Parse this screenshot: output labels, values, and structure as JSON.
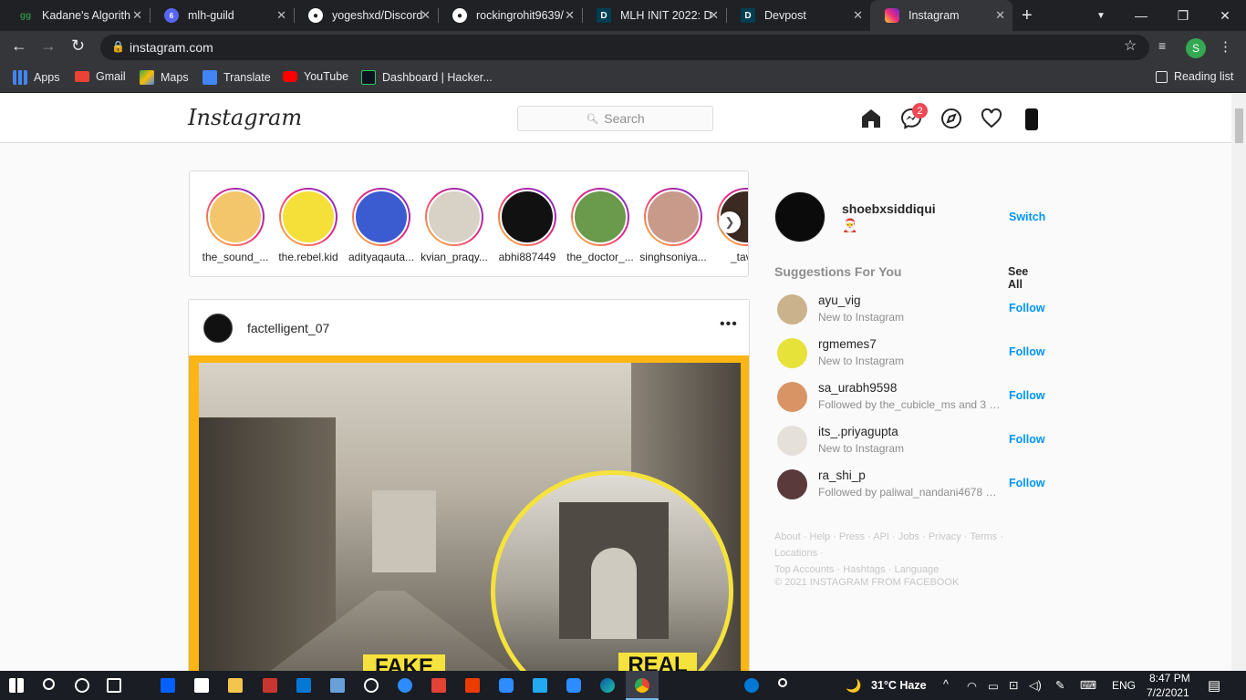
{
  "browser": {
    "tabs": [
      {
        "title": "Kadane's Algorith",
        "icon": "gfg-icon",
        "icon_color": "#2f8d46",
        "icon_text": "gg",
        "active": false
      },
      {
        "title": "mlh-guild",
        "icon": "discord-icon",
        "icon_color": "#5865f2",
        "icon_text": "6",
        "active": false
      },
      {
        "title": "yogeshxd/Discord",
        "icon": "github-icon",
        "icon_color": "#ffffff",
        "icon_text": "",
        "active": false
      },
      {
        "title": "rockingrohit9639/",
        "icon": "github-icon",
        "icon_color": "#ffffff",
        "icon_text": "",
        "active": false
      },
      {
        "title": "MLH INIT 2022: D",
        "icon": "devpost-icon",
        "icon_color": "#003e54",
        "icon_text": "D",
        "active": false
      },
      {
        "title": "Devpost",
        "icon": "devpost-icon",
        "icon_color": "#003e54",
        "icon_text": "D",
        "active": false
      },
      {
        "title": "Instagram",
        "icon": "instagram-icon",
        "icon_color": "#e1306c",
        "icon_text": "",
        "active": true
      }
    ],
    "url": "instagram.com",
    "profile_initial": "S",
    "bookmarks": [
      {
        "label": "Apps",
        "icon": "apps-grid-icon",
        "color": "#4285f4"
      },
      {
        "label": "Gmail",
        "icon": "gmail-icon",
        "color": "#ea4335"
      },
      {
        "label": "Maps",
        "icon": "maps-icon",
        "color": "#34a853"
      },
      {
        "label": "Translate",
        "icon": "translate-icon",
        "color": "#4285f4"
      },
      {
        "label": "YouTube",
        "icon": "youtube-icon",
        "color": "#ff0000"
      },
      {
        "label": "Dashboard | Hacker...",
        "icon": "hackerrank-icon",
        "color": "#2ec866"
      }
    ],
    "reading_list": "Reading list"
  },
  "instagram": {
    "logo": "Instagram",
    "search_placeholder": "Search",
    "messenger_badge": "2",
    "stories": [
      {
        "name": "the_sound_...",
        "color": "#f3c66b"
      },
      {
        "name": "the.rebel.kid",
        "color": "#f5e03a"
      },
      {
        "name": "adityaqauta...",
        "color": "#3b5bd1"
      },
      {
        "name": "kvian_praqy...",
        "color": "#d8d2c6"
      },
      {
        "name": "abhi887449",
        "color": "#111111"
      },
      {
        "name": "the_doctor_...",
        "color": "#6a9a4b"
      },
      {
        "name": "singhsoniya...",
        "color": "#c79a8a"
      },
      {
        "name": "_tavisl",
        "color": "#3b2a22"
      }
    ],
    "post": {
      "username": "factelligent_07",
      "more": "•••",
      "label_fake": "FAKE",
      "label_real": "REAL"
    },
    "sidebar": {
      "username": "shoebxsiddiqui",
      "emoji": "🎅",
      "switch": "Switch",
      "suggestions_title": "Suggestions For You",
      "see_all": "See All",
      "suggestions": [
        {
          "username": "ayu_vig",
          "sub": "New to Instagram",
          "follow": "Follow",
          "color": "#c9b28c"
        },
        {
          "username": "rgmemes7",
          "sub": "New to Instagram",
          "follow": "Follow",
          "color": "#e7e23a"
        },
        {
          "username": "sa_urabh9598",
          "sub": "Followed by the_cubicle_ms and 3 o...",
          "follow": "Follow",
          "color": "#d99466"
        },
        {
          "username": "its_.priyagupta",
          "sub": "New to Instagram",
          "follow": "Follow",
          "color": "#e5e0da"
        },
        {
          "username": "ra_shi_p",
          "sub": "Followed by paliwal_nandani4678 a...",
          "follow": "Follow",
          "color": "#5a3a3a"
        }
      ],
      "footer_line1": "About · Help · Press · API · Jobs · Privacy · Terms · Locations ·",
      "footer_line2": "Top Accounts · Hashtags · Language",
      "copyright": "© 2021 INSTAGRAM FROM FACEBOOK"
    }
  },
  "taskbar": {
    "weather": "31°C  Haze",
    "lang": "ENG",
    "time": "8:47 PM",
    "date": "7/2/2021"
  }
}
